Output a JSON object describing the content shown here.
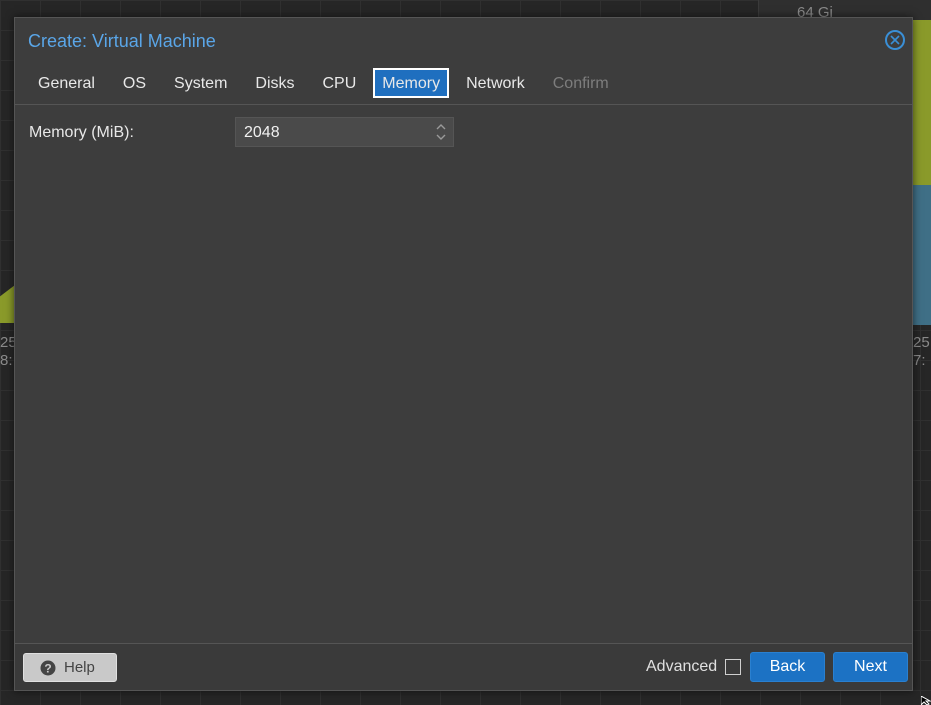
{
  "background": {
    "top_label": "64 Gi",
    "left_labels": [
      "25",
      "8:"
    ],
    "right_labels": [
      "25",
      "7:"
    ]
  },
  "dialog": {
    "title": "Create: Virtual Machine",
    "close_icon": "close-circle-icon",
    "tabs": [
      {
        "label": "General",
        "state": "normal"
      },
      {
        "label": "OS",
        "state": "normal"
      },
      {
        "label": "System",
        "state": "normal"
      },
      {
        "label": "Disks",
        "state": "normal"
      },
      {
        "label": "CPU",
        "state": "normal"
      },
      {
        "label": "Memory",
        "state": "active"
      },
      {
        "label": "Network",
        "state": "normal"
      },
      {
        "label": "Confirm",
        "state": "disabled"
      }
    ],
    "memory": {
      "label": "Memory (MiB):",
      "value": "2048"
    },
    "footer": {
      "help_label": "Help",
      "advanced_label": "Advanced",
      "advanced_checked": false,
      "back_label": "Back",
      "next_label": "Next"
    }
  },
  "colors": {
    "accent": "#1c72c4",
    "title": "#5aa6e8",
    "panel": "#3d3d3d"
  }
}
